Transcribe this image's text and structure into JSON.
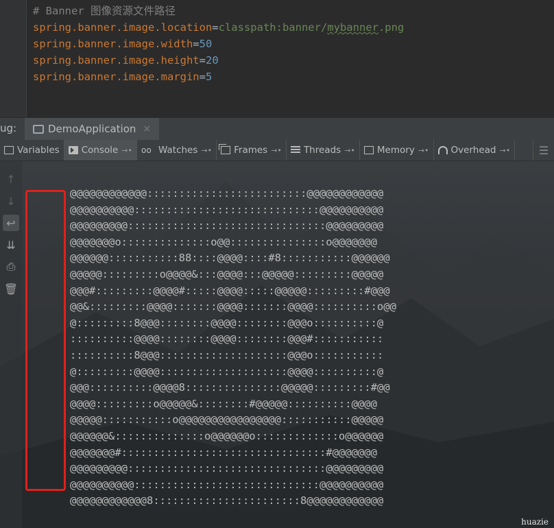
{
  "editor": {
    "comment": "# Banner 图像资源文件路径",
    "lines": [
      {
        "key": "spring.banner.image.location",
        "eq": "=",
        "value_prefix": "classpath:banner/",
        "value_typo": "mybanner",
        "value_suffix": ".png"
      },
      {
        "key": "spring.banner.image.width",
        "eq": "=",
        "value": "50"
      },
      {
        "key": "spring.banner.image.height",
        "eq": "=",
        "value": "20"
      },
      {
        "key": "spring.banner.image.margin",
        "eq": "=",
        "value": "5"
      }
    ]
  },
  "debug_panel": {
    "label": "ug:",
    "session_tab": "DemoApplication",
    "close_glyph": "×",
    "tabs": [
      {
        "label": "Variables",
        "icon": "variables-icon"
      },
      {
        "label": "Console",
        "icon": "console-icon",
        "active": true
      },
      {
        "label": "Watches",
        "icon": "watches-icon"
      },
      {
        "label": "Frames",
        "icon": "frames-icon"
      },
      {
        "label": "Threads",
        "icon": "threads-icon"
      },
      {
        "label": "Memory",
        "icon": "memory-icon"
      },
      {
        "label": "Overhead",
        "icon": "overhead-icon"
      }
    ],
    "pin_glyph": "→•",
    "menu_glyph": "☰"
  },
  "side_toolbar": [
    {
      "name": "up-arrow-icon",
      "glyph": "↑"
    },
    {
      "name": "down-arrow-icon",
      "glyph": "↓"
    },
    {
      "name": "soft-wrap-icon",
      "glyph": "↩"
    },
    {
      "name": "scroll-to-end-icon",
      "glyph": "⇊"
    },
    {
      "name": "print-icon",
      "glyph": "⎙"
    },
    {
      "name": "trash-icon",
      "glyph": "🗑"
    }
  ],
  "console_output": [
    "@@@@@@@@@@@@:::::::::::::::::::::::::@@@@@@@@@@@@",
    "@@@@@@@@@@:::::::::::::::::::::::::::::@@@@@@@@@@",
    "@@@@@@@@@:::::::::::::::::::::::::::::::@@@@@@@@@",
    "@@@@@@@o::::::::::::::o@@:::::::::::::::o@@@@@@@",
    "@@@@@@:::::::::::88::::@@@@::::#8:::::::::::@@@@@@",
    "@@@@@:::::::::o@@@@&:::@@@@:::@@@@@:::::::::@@@@@",
    "@@@#:::::::::@@@@#:::::@@@@:::::@@@@@:::::::::#@@@",
    "@@&:::::::::@@@@:::::::@@@@:::::::@@@@::::::::::o@@",
    "@:::::::::8@@@::::::::@@@@::::::::@@@o::::::::::@",
    "::::::::::@@@@::::::::@@@@::::::::@@@#:::::::::::",
    "::::::::::8@@@::::::::::::::::::::@@@o:::::::::::",
    "@:::::::::@@@@::::::::::::::::::::@@@@::::::::::@",
    "@@@::::::::::@@@@8:::::::::::::::@@@@@:::::::::#@@",
    "@@@@:::::::::o@@@@@&::::::::#@@@@@::::::::::@@@@",
    "@@@@@:::::::::::o@@@@@@@@@@@@@@@@:::::::::::@@@@@",
    "@@@@@@&::::::::::::::o@@@@@@o:::::::::::::o@@@@@@",
    "@@@@@@@#::::::::::::::::::::::::::::::::#@@@@@@@",
    "@@@@@@@@@:::::::::::::::::::::::::::::::@@@@@@@@@",
    "@@@@@@@@@@:::::::::::::::::::::::::::::@@@@@@@@@@",
    "@@@@@@@@@@@@8:::::::::::::::::::::::8@@@@@@@@@@@@"
  ],
  "colors": {
    "highlight_box": "#e0211b",
    "keyword": "#cc7832",
    "string": "#6a8759",
    "number": "#6897bb",
    "comment": "#808080"
  },
  "watermark": "huazie"
}
